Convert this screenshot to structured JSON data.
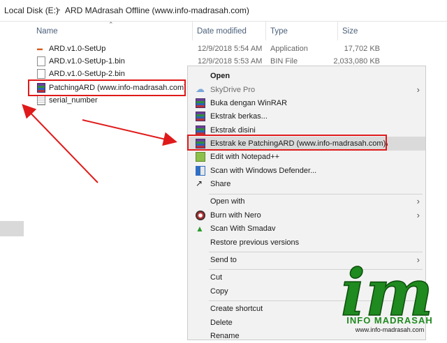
{
  "breadcrumb": {
    "drive": "Local Disk (E:)",
    "separator": ">",
    "folder": "ARD MAdrasah Offline (www.info-madrasah.com)"
  },
  "columns": {
    "name": "Name",
    "date": "Date modified",
    "type": "Type",
    "size": "Size"
  },
  "files": [
    {
      "name": "ARD.v1.0-SetUp",
      "date": "12/9/2018 5:54 AM",
      "type": "Application",
      "size": "17,702 KB",
      "icon": "app-icon"
    },
    {
      "name": "ARD.v1.0-SetUp-1.bin",
      "date": "12/9/2018 5:53 AM",
      "type": "BIN File",
      "size": "2,033,080 KB",
      "icon": "document-icon"
    },
    {
      "name": "ARD.v1.0-SetUp-2.bin",
      "date": "",
      "type": "",
      "size": "",
      "icon": "document-icon"
    },
    {
      "name": "PatchingARD (www.info-madrasah.com)",
      "date": "",
      "type": "",
      "size": "",
      "icon": "winrar-archive-icon"
    },
    {
      "name": "serial_number",
      "date": "",
      "type": "",
      "size": "",
      "icon": "text-file-icon"
    }
  ],
  "context_menu": {
    "open": "Open",
    "skydrive": "SkyDrive Pro",
    "buka_winrar": "Buka dengan WinRAR",
    "ekstrak_berkas": "Ekstrak berkas...",
    "ekstrak_disini": "Ekstrak disini",
    "ekstrak_ke": "Ekstrak ke PatchingARD (www.info-madrasah.com)\\",
    "notepad": "Edit with Notepad++",
    "defender": "Scan with Windows Defender...",
    "share": "Share",
    "open_with": "Open with",
    "burn_nero": "Burn with Nero",
    "smadav": "Scan With Smadav",
    "restore": "Restore previous versions",
    "send_to": "Send to",
    "cut": "Cut",
    "copy": "Copy",
    "create_shortcut": "Create shortcut",
    "delete": "Delete",
    "rename": "Rename"
  },
  "watermark": {
    "logo_text": "im",
    "brand": "INFO MADRASAH",
    "url": "www.info-madrasah.com"
  },
  "colors": {
    "highlight_border": "#e01a1a",
    "annotation_arrow": "#e01a1a",
    "menu_background": "#f2f2f2",
    "logo_green": "#1f8a1f"
  }
}
